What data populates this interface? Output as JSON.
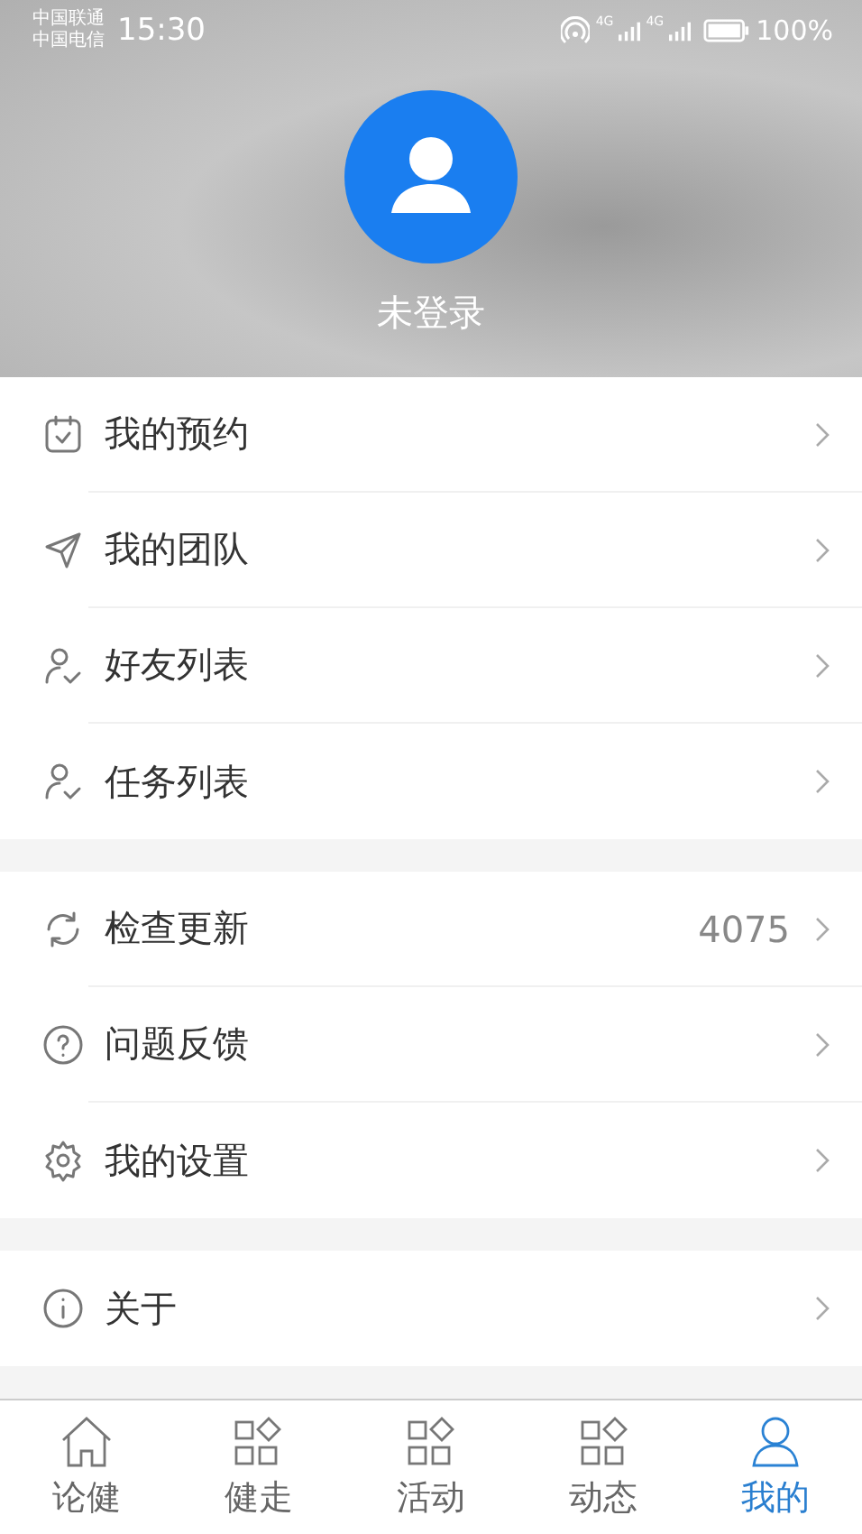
{
  "status_bar": {
    "carriers": [
      "中国联通",
      "中国电信"
    ],
    "time": "15:30",
    "signal_labels": [
      "4G",
      "4G"
    ],
    "battery": "100%"
  },
  "profile": {
    "name": "未登录"
  },
  "menu_groups": [
    {
      "items": [
        {
          "label": "我的预约"
        },
        {
          "label": "我的团队"
        },
        {
          "label": "好友列表"
        },
        {
          "label": "任务列表"
        }
      ]
    },
    {
      "items": [
        {
          "label": "检查更新",
          "value": "4075"
        },
        {
          "label": "问题反馈"
        },
        {
          "label": "我的设置"
        }
      ]
    },
    {
      "items": [
        {
          "label": "关于"
        }
      ]
    }
  ],
  "tabs": [
    {
      "label": "论健",
      "selected": false
    },
    {
      "label": "健走",
      "selected": false
    },
    {
      "label": "活动",
      "selected": false
    },
    {
      "label": "动态",
      "selected": false
    },
    {
      "label": "我的",
      "selected": true
    }
  ]
}
